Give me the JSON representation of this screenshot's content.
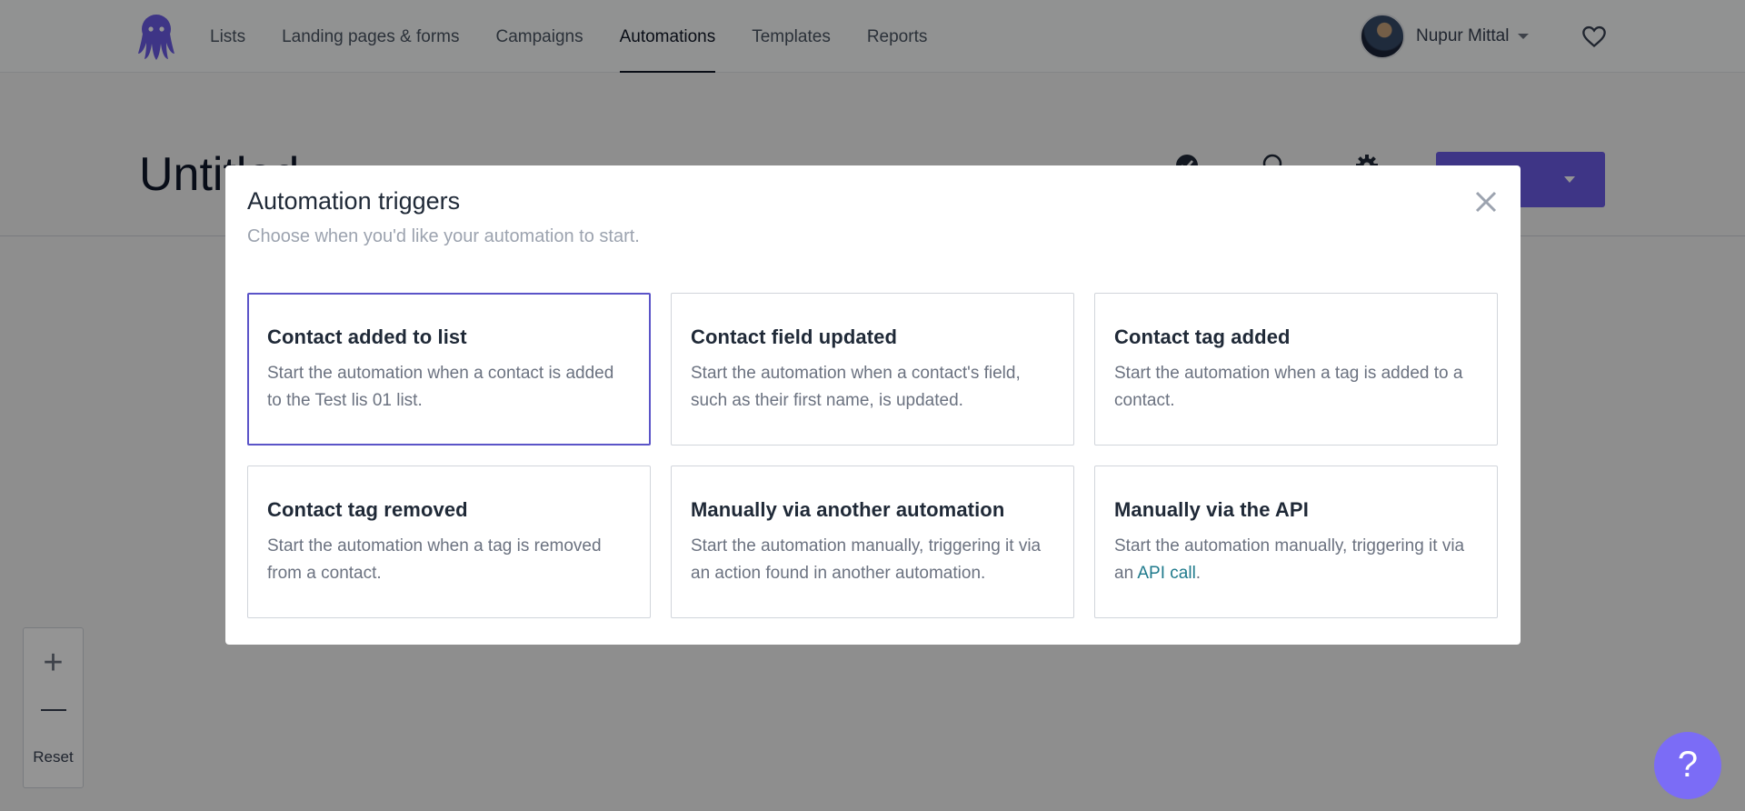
{
  "nav": {
    "items": [
      {
        "label": "Lists",
        "active": false
      },
      {
        "label": "Landing pages & forms",
        "active": false
      },
      {
        "label": "Campaigns",
        "active": false
      },
      {
        "label": "Automations",
        "active": true
      },
      {
        "label": "Templates",
        "active": false
      },
      {
        "label": "Reports",
        "active": false
      }
    ],
    "user_name": "Nupur Mittal"
  },
  "page": {
    "title": "Untitled"
  },
  "zoom": {
    "in_symbol": "+",
    "reset_label": "Reset"
  },
  "help": {
    "symbol": "?"
  },
  "modal": {
    "title": "Automation triggers",
    "subtitle": "Choose when you'd like your automation to start.",
    "cards": [
      {
        "title": "Contact added to list",
        "desc": "Start the automation when a contact is added to the Test lis 01 list.",
        "selected": true
      },
      {
        "title": "Contact field updated",
        "desc": "Start the automation when a contact's field, such as their first name, is updated."
      },
      {
        "title": "Contact tag added",
        "desc": "Start the automation when a tag is added to a contact."
      },
      {
        "title": "Contact tag removed",
        "desc": "Start the automation when a tag is removed from a contact."
      },
      {
        "title": "Manually via another automation",
        "desc": "Start the automation manually, triggering it via an action found in another automation."
      },
      {
        "title": "Manually via the API",
        "desc_before": "Start the automation manually, triggering it via an ",
        "desc_link": "API call",
        "desc_after": "."
      }
    ]
  },
  "colors": {
    "accent": "#6c5ce7",
    "selected_border": "#5b54c8",
    "link": "#1f7a8c",
    "overlay": "rgba(0,0,0,0.42)"
  },
  "icons": [
    "octopus-logo-icon",
    "heart-icon",
    "check-icon",
    "search-icon",
    "gear-icon",
    "close-icon",
    "chevron-down-icon"
  ]
}
